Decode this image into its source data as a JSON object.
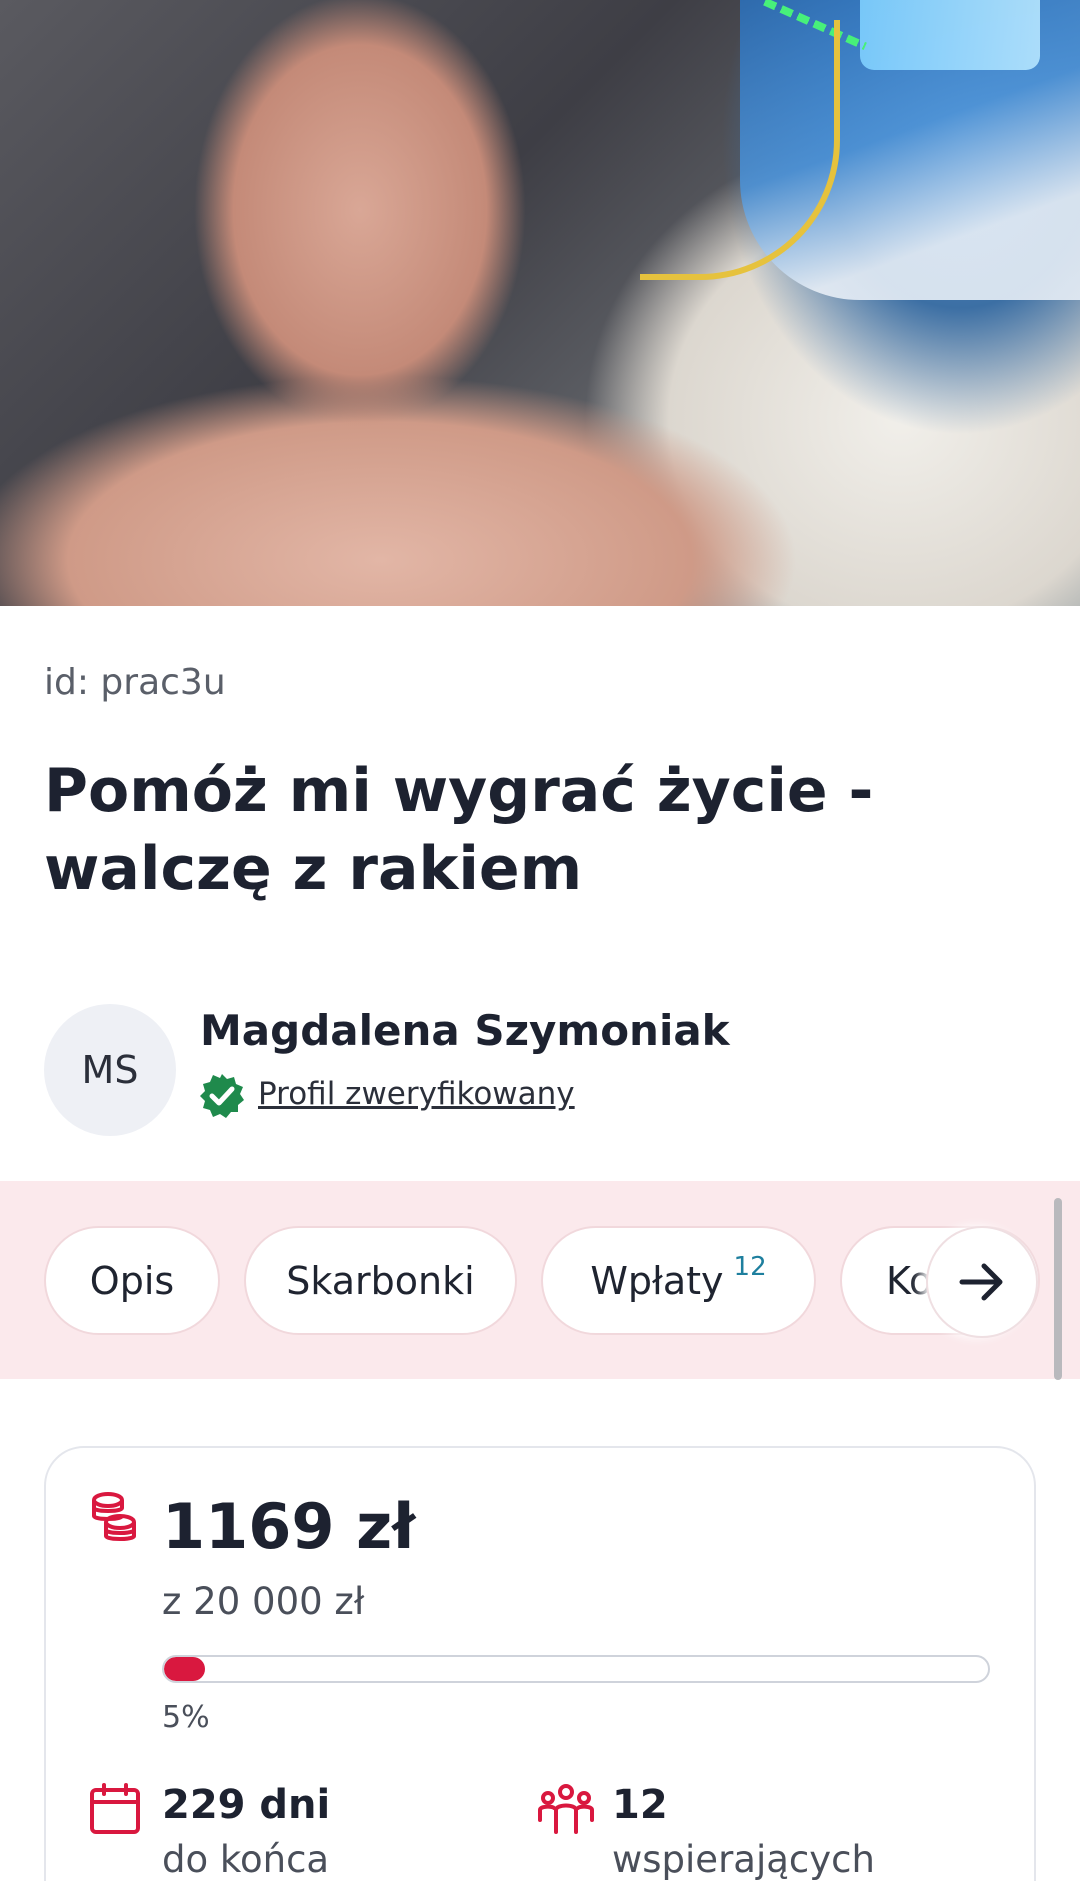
{
  "campaign": {
    "id_text": "id: prac3u",
    "title": "Pomóż mi wygrać życie - walczę z rakiem",
    "hero_image": "hospital-selfie-photo"
  },
  "organizer": {
    "initials": "MS",
    "name": "Magdalena Szymoniak",
    "verified_label": "Profil zweryfikowany"
  },
  "tabs": [
    {
      "label": "Opis"
    },
    {
      "label": "Skarbonki"
    },
    {
      "label": "Wpłaty",
      "badge": "12"
    },
    {
      "label": "Ko"
    }
  ],
  "tabs_next_icon": "arrow-right-icon",
  "stats": {
    "raised": "1169 zł",
    "goal": "z 20 000 zł",
    "progress_percent": 5,
    "percent_label": "5%",
    "days_value": "229 dni",
    "days_label": "do końca",
    "supporters_value": "12",
    "supporters_label": "wspierających"
  },
  "colors": {
    "accent": "#d9183f",
    "tab_strip_bg": "#fbe9ec",
    "verified_green": "#1f8a4c",
    "badge_teal": "#1e7f9e"
  }
}
